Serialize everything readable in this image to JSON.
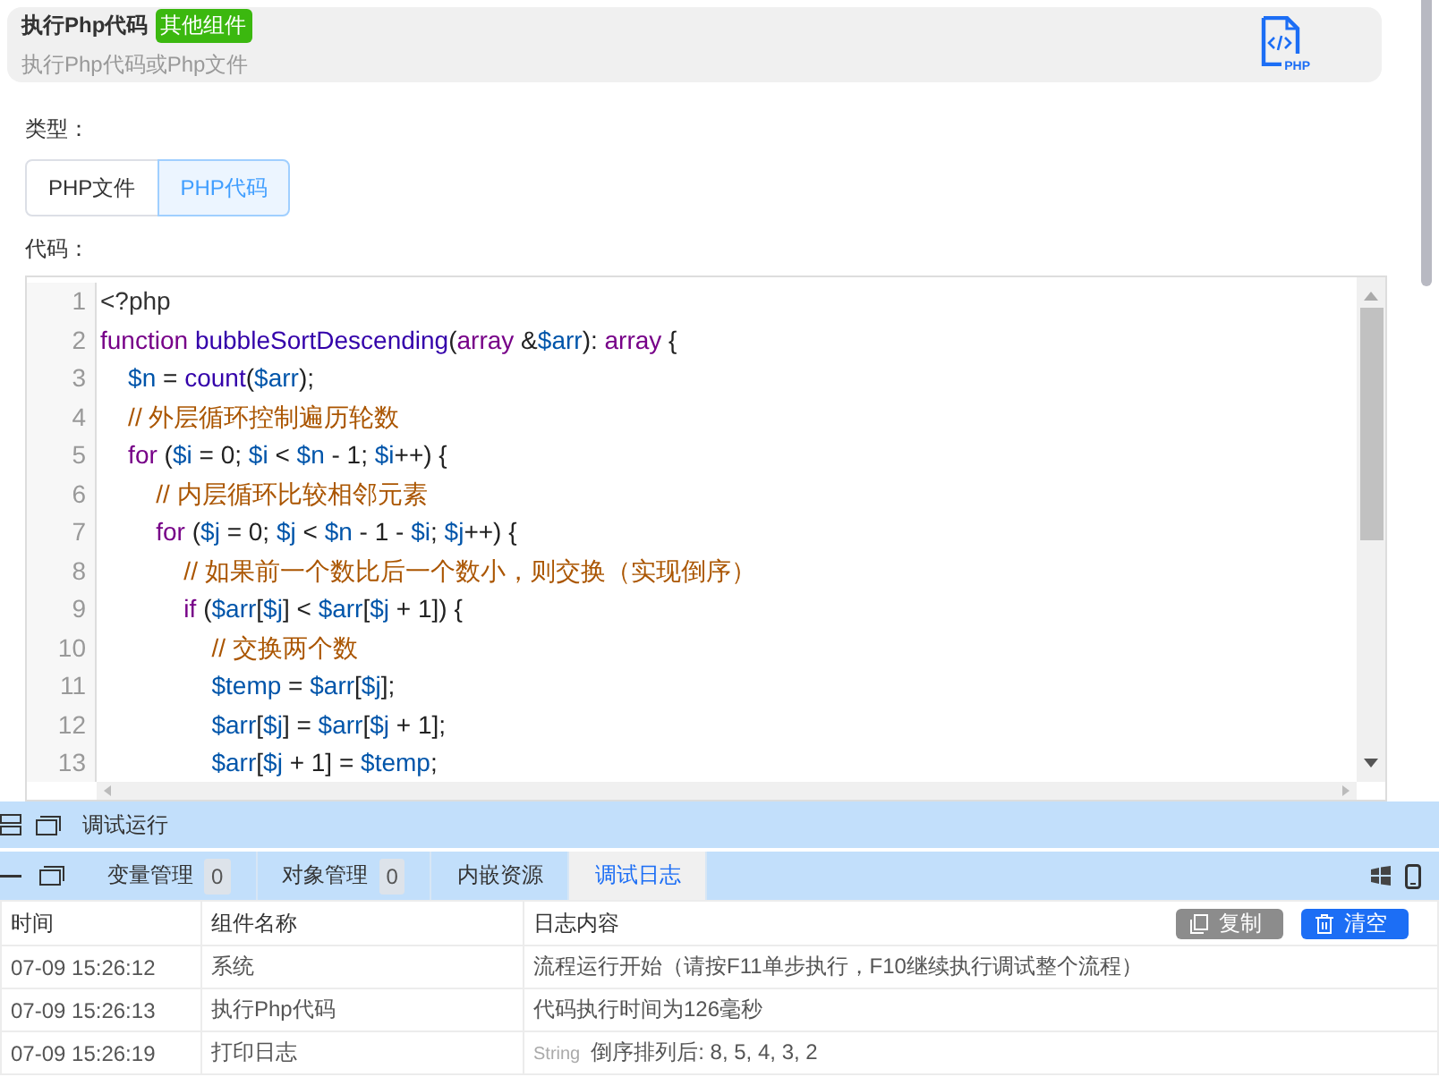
{
  "header": {
    "title": "执行Php代码",
    "badge": "其他组件",
    "subtitle": "执行Php代码或Php文件",
    "icon_label": "PHP"
  },
  "type_field": {
    "label": "类型：",
    "options": [
      {
        "label": "PHP文件",
        "selected": false
      },
      {
        "label": "PHP代码",
        "selected": true
      }
    ]
  },
  "code_field": {
    "label": "代码：",
    "lines": [
      {
        "number": "1",
        "tokens": [
          {
            "kind": "meta",
            "text": "<?php"
          }
        ]
      },
      {
        "number": "2",
        "tokens": [
          {
            "kind": "kw",
            "text": "function "
          },
          {
            "kind": "fn",
            "text": "bubbleSortDescending"
          },
          {
            "kind": "op",
            "text": "("
          },
          {
            "kind": "kw",
            "text": "array"
          },
          {
            "kind": "op",
            "text": " &"
          },
          {
            "kind": "var",
            "text": "$arr"
          },
          {
            "kind": "op",
            "text": "): "
          },
          {
            "kind": "kw",
            "text": "array"
          },
          {
            "kind": "op",
            "text": " {"
          }
        ]
      },
      {
        "number": "3",
        "tokens": [
          {
            "kind": "var",
            "text": "    $n"
          },
          {
            "kind": "op",
            "text": " = "
          },
          {
            "kind": "fn",
            "text": "count"
          },
          {
            "kind": "op",
            "text": "("
          },
          {
            "kind": "var",
            "text": "$arr"
          },
          {
            "kind": "op",
            "text": ");"
          }
        ]
      },
      {
        "number": "4",
        "tokens": [
          {
            "kind": "cm",
            "text": "    // 外层循环控制遍历轮数"
          }
        ]
      },
      {
        "number": "5",
        "tokens": [
          {
            "kind": "kw",
            "text": "    for"
          },
          {
            "kind": "op",
            "text": " ("
          },
          {
            "kind": "var",
            "text": "$i"
          },
          {
            "kind": "op",
            "text": " = 0; "
          },
          {
            "kind": "var",
            "text": "$i"
          },
          {
            "kind": "op",
            "text": " < "
          },
          {
            "kind": "var",
            "text": "$n"
          },
          {
            "kind": "op",
            "text": " - 1; "
          },
          {
            "kind": "var",
            "text": "$i"
          },
          {
            "kind": "op",
            "text": "++) {"
          }
        ]
      },
      {
        "number": "6",
        "tokens": [
          {
            "kind": "cm",
            "text": "        // 内层循环比较相邻元素"
          }
        ]
      },
      {
        "number": "7",
        "tokens": [
          {
            "kind": "kw",
            "text": "        for"
          },
          {
            "kind": "op",
            "text": " ("
          },
          {
            "kind": "var",
            "text": "$j"
          },
          {
            "kind": "op",
            "text": " = 0; "
          },
          {
            "kind": "var",
            "text": "$j"
          },
          {
            "kind": "op",
            "text": " < "
          },
          {
            "kind": "var",
            "text": "$n"
          },
          {
            "kind": "op",
            "text": " - 1 - "
          },
          {
            "kind": "var",
            "text": "$i"
          },
          {
            "kind": "op",
            "text": "; "
          },
          {
            "kind": "var",
            "text": "$j"
          },
          {
            "kind": "op",
            "text": "++) {"
          }
        ]
      },
      {
        "number": "8",
        "tokens": [
          {
            "kind": "cm",
            "text": "            // 如果前一个数比后一个数小，则交换（实现倒序）"
          }
        ]
      },
      {
        "number": "9",
        "tokens": [
          {
            "kind": "kw",
            "text": "            if"
          },
          {
            "kind": "op",
            "text": " ("
          },
          {
            "kind": "var",
            "text": "$arr"
          },
          {
            "kind": "op",
            "text": "["
          },
          {
            "kind": "var",
            "text": "$j"
          },
          {
            "kind": "op",
            "text": "] < "
          },
          {
            "kind": "var",
            "text": "$arr"
          },
          {
            "kind": "op",
            "text": "["
          },
          {
            "kind": "var",
            "text": "$j"
          },
          {
            "kind": "op",
            "text": " + 1]) {"
          }
        ]
      },
      {
        "number": "10",
        "tokens": [
          {
            "kind": "cm",
            "text": "                // 交换两个数"
          }
        ]
      },
      {
        "number": "11",
        "tokens": [
          {
            "kind": "var",
            "text": "                $temp"
          },
          {
            "kind": "op",
            "text": " = "
          },
          {
            "kind": "var",
            "text": "$arr"
          },
          {
            "kind": "op",
            "text": "["
          },
          {
            "kind": "var",
            "text": "$j"
          },
          {
            "kind": "op",
            "text": "];"
          }
        ]
      },
      {
        "number": "12",
        "tokens": [
          {
            "kind": "var",
            "text": "                $arr"
          },
          {
            "kind": "op",
            "text": "["
          },
          {
            "kind": "var",
            "text": "$j"
          },
          {
            "kind": "op",
            "text": "] = "
          },
          {
            "kind": "var",
            "text": "$arr"
          },
          {
            "kind": "op",
            "text": "["
          },
          {
            "kind": "var",
            "text": "$j"
          },
          {
            "kind": "op",
            "text": " + 1];"
          }
        ]
      },
      {
        "number": "13",
        "tokens": [
          {
            "kind": "var",
            "text": "                $arr"
          },
          {
            "kind": "op",
            "text": "["
          },
          {
            "kind": "var",
            "text": "$j"
          },
          {
            "kind": "op",
            "text": " + 1] = "
          },
          {
            "kind": "var",
            "text": "$temp"
          },
          {
            "kind": "op",
            "text": ";"
          }
        ]
      }
    ]
  },
  "debug_panel": {
    "title": "调试运行",
    "tabs": [
      {
        "label": "变量管理",
        "count": "0",
        "selected": false
      },
      {
        "label": "对象管理",
        "count": "0",
        "selected": false
      },
      {
        "label": "内嵌资源",
        "selected": false
      },
      {
        "label": "调试日志",
        "selected": true
      }
    ],
    "log_table": {
      "columns": [
        "时间",
        "组件名称",
        "日志内容"
      ],
      "actions": [
        {
          "label": "复制",
          "kind": "copy"
        },
        {
          "label": "清空",
          "kind": "clear"
        }
      ],
      "rows": [
        {
          "time": "07-09 15:26:12",
          "component": "系统",
          "message": "流程运行开始（请按F11单步执行，F10继续执行调试整个流程）"
        },
        {
          "time": "07-09 15:26:13",
          "component": "执行Php代码",
          "message": "代码执行时间为126毫秒"
        },
        {
          "time": "07-09 15:26:19",
          "component": "打印日志",
          "type_tag": "String",
          "message": "倒序排列后: 8, 5, 4, 3, 2"
        }
      ]
    }
  }
}
